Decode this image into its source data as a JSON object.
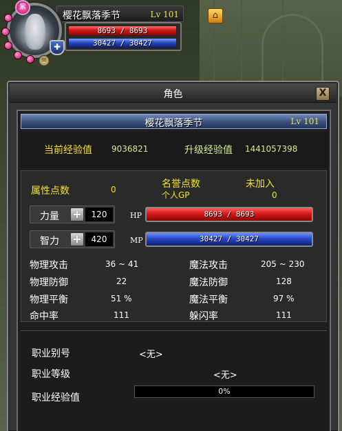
{
  "hud": {
    "name": "樱花飘落季节",
    "level": "Lv 101",
    "badge": "紫",
    "hp_text": "8693 / 8693",
    "mp_text": "30427 / 30427",
    "hp_fraction": 1.0,
    "mp_fraction": 1.0
  },
  "window": {
    "title": "角色",
    "close_label": "X"
  },
  "character": {
    "name": "樱花飘落季节",
    "level": "Lv 101"
  },
  "experience": {
    "current_label": "当前经验值",
    "current_value": "9036821",
    "next_label": "升级经验值",
    "next_value": "1441057398"
  },
  "points": {
    "attr_label": "属性点数",
    "attr_value": "0",
    "honor_label": "名誉点数",
    "honor_value": "未加入",
    "gp_label": "个人GP",
    "gp_value": "0"
  },
  "stats": {
    "strength_label": "力量",
    "strength_value": "120",
    "intelligence_label": "智力",
    "intelligence_value": "420",
    "plus_label": "+"
  },
  "bars": {
    "hp_tag": "HP",
    "hp_text": "8693 / 8693",
    "hp_fraction": 1.0,
    "mp_tag": "MP",
    "mp_text": "30427 / 30427",
    "mp_fraction": 1.0
  },
  "attributes": [
    {
      "label": "物理攻击",
      "value": "36 ~ 41"
    },
    {
      "label": "魔法攻击",
      "value": "205 ~ 230"
    },
    {
      "label": "物理防御",
      "value": "22"
    },
    {
      "label": "魔法防御",
      "value": "128"
    },
    {
      "label": "物理平衡",
      "value": "51 %"
    },
    {
      "label": "魔法平衡",
      "value": "97 %"
    },
    {
      "label": "命中率",
      "value": "111"
    },
    {
      "label": "躲闪率",
      "value": "111"
    }
  ],
  "job": {
    "alias_label": "职业别号",
    "alias_value": "<无>",
    "level_label": "职业等级",
    "level_value": "<无>",
    "exp_label": "职业经验值",
    "exp_text": "0%",
    "exp_fraction": 0
  },
  "icons": {
    "shield": "shield-icon",
    "event": "event-icon",
    "menu": "menu-icon"
  },
  "colors": {
    "highlight_yellow": "#f2e030",
    "value_lime": "#d8e89a",
    "hp_red": "#d41818",
    "mp_blue": "#2848c8"
  }
}
